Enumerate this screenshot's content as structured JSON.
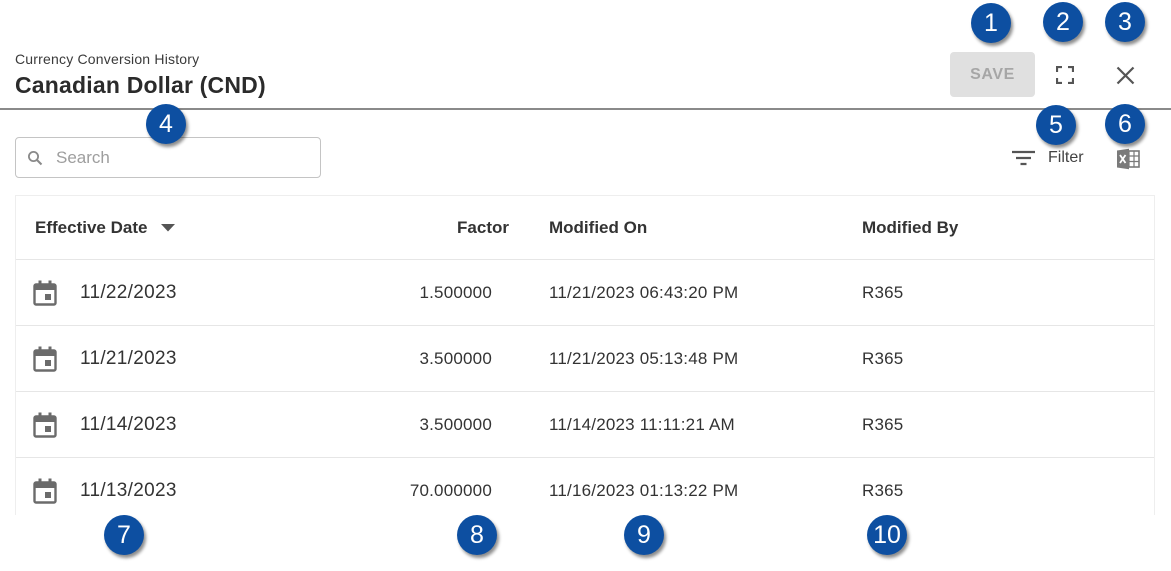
{
  "header": {
    "subtitle": "Currency Conversion History",
    "title": "Canadian Dollar (CND)",
    "save_label": "SAVE",
    "expand_icon": "fullscreen-icon",
    "close_icon": "close-icon"
  },
  "toolbar": {
    "search_placeholder": "Search",
    "search_value": "",
    "filter_label": "Filter",
    "filter_icon": "filter-lines-icon",
    "export_icon": "excel-icon"
  },
  "table": {
    "columns": {
      "effective_date": "Effective Date",
      "factor": "Factor",
      "modified_on": "Modified On",
      "modified_by": "Modified By"
    },
    "sort": {
      "column": "effective_date",
      "direction": "descending"
    },
    "rows": [
      {
        "effective_date": "11/22/2023",
        "factor": "1.500000",
        "modified_on": "11/21/2023 06:43:20 PM",
        "modified_by": "R365"
      },
      {
        "effective_date": "11/21/2023",
        "factor": "3.500000",
        "modified_on": "11/21/2023 05:13:48 PM",
        "modified_by": "R365"
      },
      {
        "effective_date": "11/14/2023",
        "factor": "3.500000",
        "modified_on": "11/14/2023 11:11:21 AM",
        "modified_by": "R365"
      },
      {
        "effective_date": "11/13/2023",
        "factor": "70.000000",
        "modified_on": "11/16/2023 01:13:22 PM",
        "modified_by": "R365"
      }
    ]
  },
  "markers": [
    "1",
    "2",
    "3",
    "4",
    "5",
    "6",
    "7",
    "8",
    "9",
    "10"
  ],
  "colors": {
    "marker_blue": "#0d4fa1",
    "save_disabled_bg": "#e0e0e0",
    "save_disabled_text": "#a6a6a6"
  }
}
